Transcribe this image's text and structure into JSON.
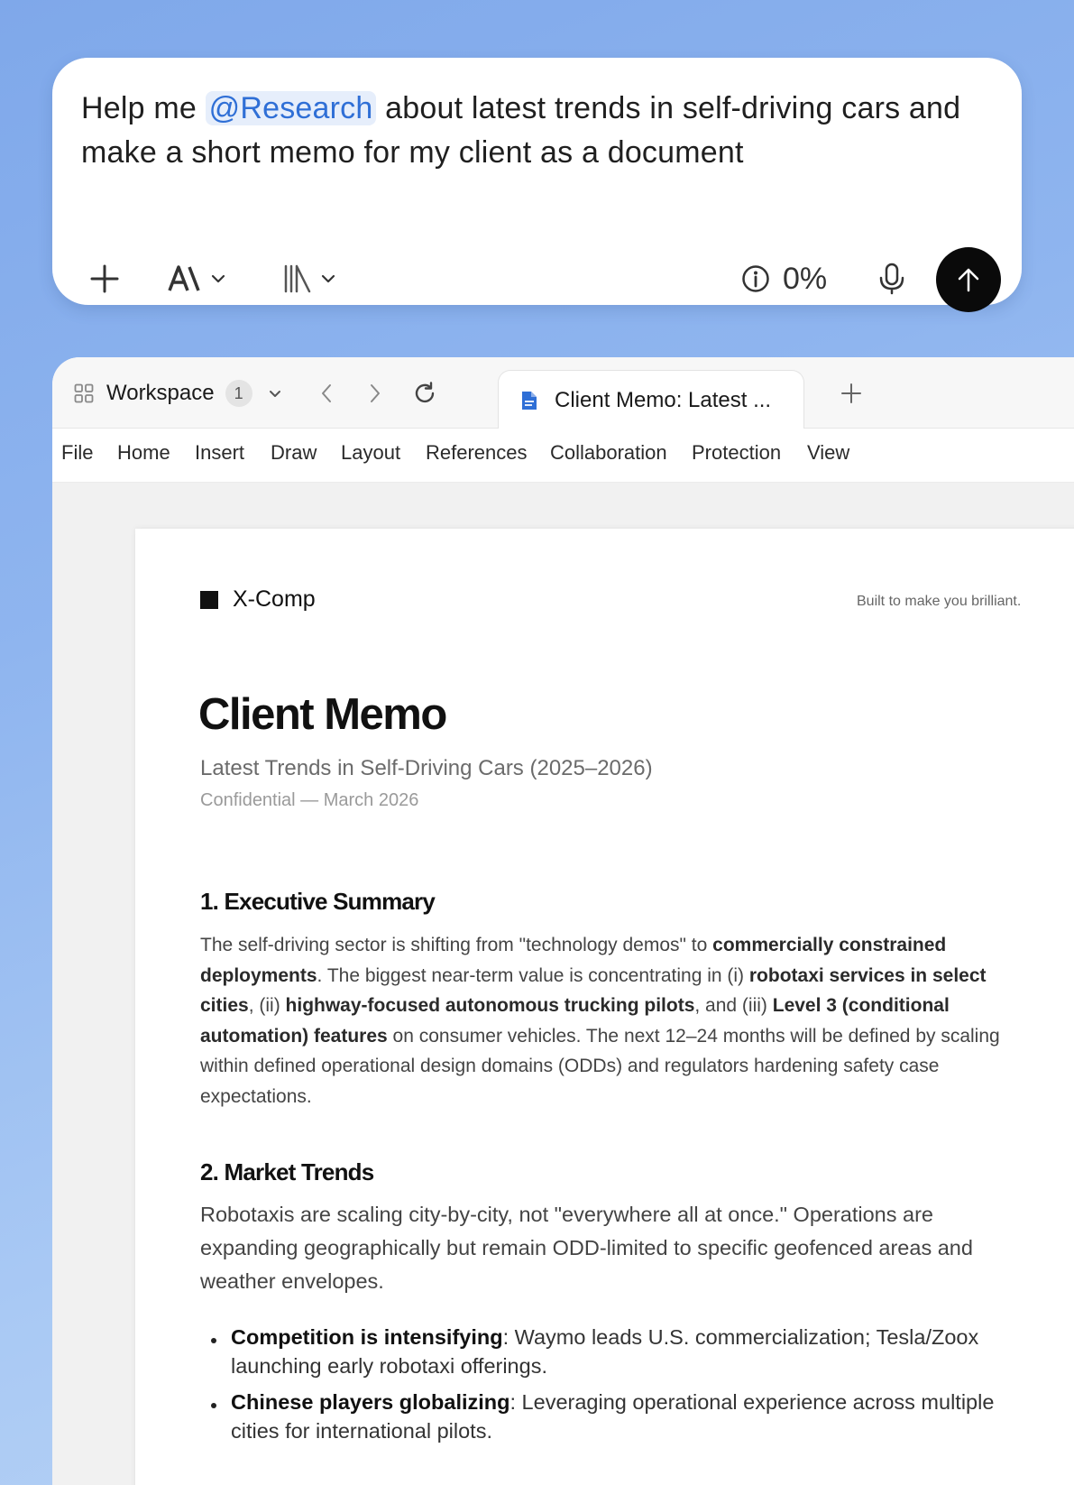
{
  "prompt": {
    "text_before": "Help me ",
    "mention": "@Research",
    "text_after": " about latest trends in self-driving cars and make a short memo for my client as a document",
    "usage_percent": "0%",
    "icons": {
      "add": "plus-icon",
      "model": "model-style-icon",
      "library": "library-icon",
      "info": "info-icon",
      "mic": "microphone-icon",
      "send": "arrow-up-icon"
    }
  },
  "tabbar": {
    "workspace_label": "Workspace",
    "workspace_count": "1",
    "active_tab_title": "Client Memo: Latest ..."
  },
  "menu": [
    "File",
    "Home",
    "Insert",
    "Draw",
    "Layout",
    "References",
    "Collaboration",
    "Protection",
    "View"
  ],
  "document": {
    "brand": "X-Comp",
    "tagline": "Built to make you brilliant.",
    "title": "Client Memo",
    "subtitle": "Latest Trends in Self-Driving Cars (2025–2026)",
    "meta": "Confidential — March 2026",
    "section1": {
      "heading": "1. Executive Summary",
      "p_1": "The self-driving sector is shifting from \"technology demos\" to ",
      "b_1": "commercially constrained deployments",
      "p_2": ". The biggest near-term value is concentrating in (i) ",
      "b_2": "robotaxi services in select cities",
      "p_3": ", (ii) ",
      "b_3": "highway-focused autonomous trucking pilots",
      "p_4": ", and (iii) ",
      "b_4": "Level 3 (conditional automation) features",
      "p_5": " on consumer vehicles. The next 12–24 months will be defined by scaling within defined operational design domains (ODDs) and regulators hardening safety case expectations."
    },
    "section2": {
      "heading": "2. Market Trends",
      "paragraph": "Robotaxis are scaling city-by-city, not \"everywhere all at once.\" Operations are expanding geographically but remain ODD-limited to specific geofenced areas and weather envelopes.",
      "bullets": [
        {
          "bold": "Competition is intensifying",
          "text": ": Waymo leads U.S. commercialization; Tesla/Zoox launching early robotaxi offerings."
        },
        {
          "bold": "Chinese players globalizing",
          "text": ": Leveraging operational experience across multiple cities for international pilots."
        }
      ]
    }
  },
  "colors": {
    "mention": "#2f6fd6",
    "send_button": "#0a0a0a",
    "doc_icon": "#2f6fd6"
  }
}
